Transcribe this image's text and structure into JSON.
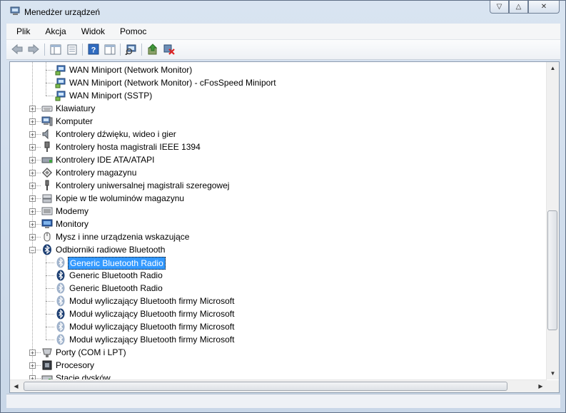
{
  "window": {
    "title": "Menedżer urządzeń",
    "caption_minimize": "▽",
    "caption_maximize": "△",
    "caption_close": "✕"
  },
  "menu": [
    "Plik",
    "Akcja",
    "Widok",
    "Pomoc"
  ],
  "toolbar": {
    "buttons": [
      "back-icon",
      "forward-icon",
      "console-tree-icon",
      "properties-icon",
      "help-icon",
      "action-pane-icon",
      "scan-hardware-icon",
      "update-driver-icon",
      "uninstall-icon"
    ]
  },
  "tree": {
    "rows": [
      {
        "text": "WAN Miniport (Network Monitor)",
        "level": 2,
        "icon": "network-adapter-icon",
        "expander": ""
      },
      {
        "text": "WAN Miniport (Network Monitor) - cFosSpeed Miniport",
        "level": 2,
        "icon": "network-adapter-icon",
        "expander": ""
      },
      {
        "text": "WAN Miniport (SSTP)",
        "level": 2,
        "icon": "network-adapter-icon",
        "expander": ""
      },
      {
        "text": "Klawiatury",
        "level": 1,
        "icon": "keyboard-icon",
        "expander": "+"
      },
      {
        "text": "Komputer",
        "level": 1,
        "icon": "computer-icon",
        "expander": "+"
      },
      {
        "text": "Kontrolery dźwięku, wideo i gier",
        "level": 1,
        "icon": "speaker-icon",
        "expander": "+"
      },
      {
        "text": "Kontrolery hosta magistrali IEEE 1394",
        "level": 1,
        "icon": "firewire-icon",
        "expander": "+"
      },
      {
        "text": "Kontrolery IDE ATA/ATAPI",
        "level": 1,
        "icon": "ide-controller-icon",
        "expander": "+"
      },
      {
        "text": "Kontrolery magazynu",
        "level": 1,
        "icon": "storage-controller-icon",
        "expander": "+"
      },
      {
        "text": "Kontrolery uniwersalnej magistrali szeregowej",
        "level": 1,
        "icon": "usb-icon",
        "expander": "+"
      },
      {
        "text": "Kopie w tle woluminów magazynu",
        "level": 1,
        "icon": "volume-shadow-icon",
        "expander": "+"
      },
      {
        "text": "Modemy",
        "level": 1,
        "icon": "modem-icon",
        "expander": "+"
      },
      {
        "text": "Monitory",
        "level": 1,
        "icon": "monitor-icon",
        "expander": "+"
      },
      {
        "text": "Mysz i inne urządzenia wskazujące",
        "level": 1,
        "icon": "mouse-icon",
        "expander": "+"
      },
      {
        "text": "Odbiorniki radiowe Bluetooth",
        "level": 1,
        "icon": "bluetooth-icon",
        "expander": "−"
      },
      {
        "text": "Generic Bluetooth Radio",
        "level": 2,
        "icon": "bluetooth-device-disabled-icon",
        "expander": "",
        "selected": true
      },
      {
        "text": "Generic Bluetooth Radio",
        "level": 2,
        "icon": "bluetooth-device-icon",
        "expander": ""
      },
      {
        "text": "Generic Bluetooth Radio",
        "level": 2,
        "icon": "bluetooth-device-disabled-icon",
        "expander": ""
      },
      {
        "text": "Moduł wyliczający Bluetooth firmy Microsoft",
        "level": 2,
        "icon": "bluetooth-device-disabled-icon",
        "expander": ""
      },
      {
        "text": "Moduł wyliczający Bluetooth firmy Microsoft",
        "level": 2,
        "icon": "bluetooth-device-icon",
        "expander": ""
      },
      {
        "text": "Moduł wyliczający Bluetooth firmy Microsoft",
        "level": 2,
        "icon": "bluetooth-device-disabled-icon",
        "expander": ""
      },
      {
        "text": "Moduł wyliczający Bluetooth firmy Microsoft",
        "level": 2,
        "icon": "bluetooth-device-disabled-icon",
        "expander": ""
      },
      {
        "text": "Porty (COM i LPT)",
        "level": 1,
        "icon": "port-icon",
        "expander": "+"
      },
      {
        "text": "Procesory",
        "level": 1,
        "icon": "processor-icon",
        "expander": "+"
      },
      {
        "text": "Stacje dysków",
        "level": 1,
        "icon": "disk-drive-icon",
        "expander": "+"
      }
    ]
  },
  "scroll": {
    "up": "▲",
    "down": "▼",
    "left": "◀",
    "right": "▶"
  },
  "colors": {
    "selection": "#3399ff",
    "bluetooth_active": "#1a3c6e",
    "bluetooth_disabled": "#8aa0bd"
  }
}
